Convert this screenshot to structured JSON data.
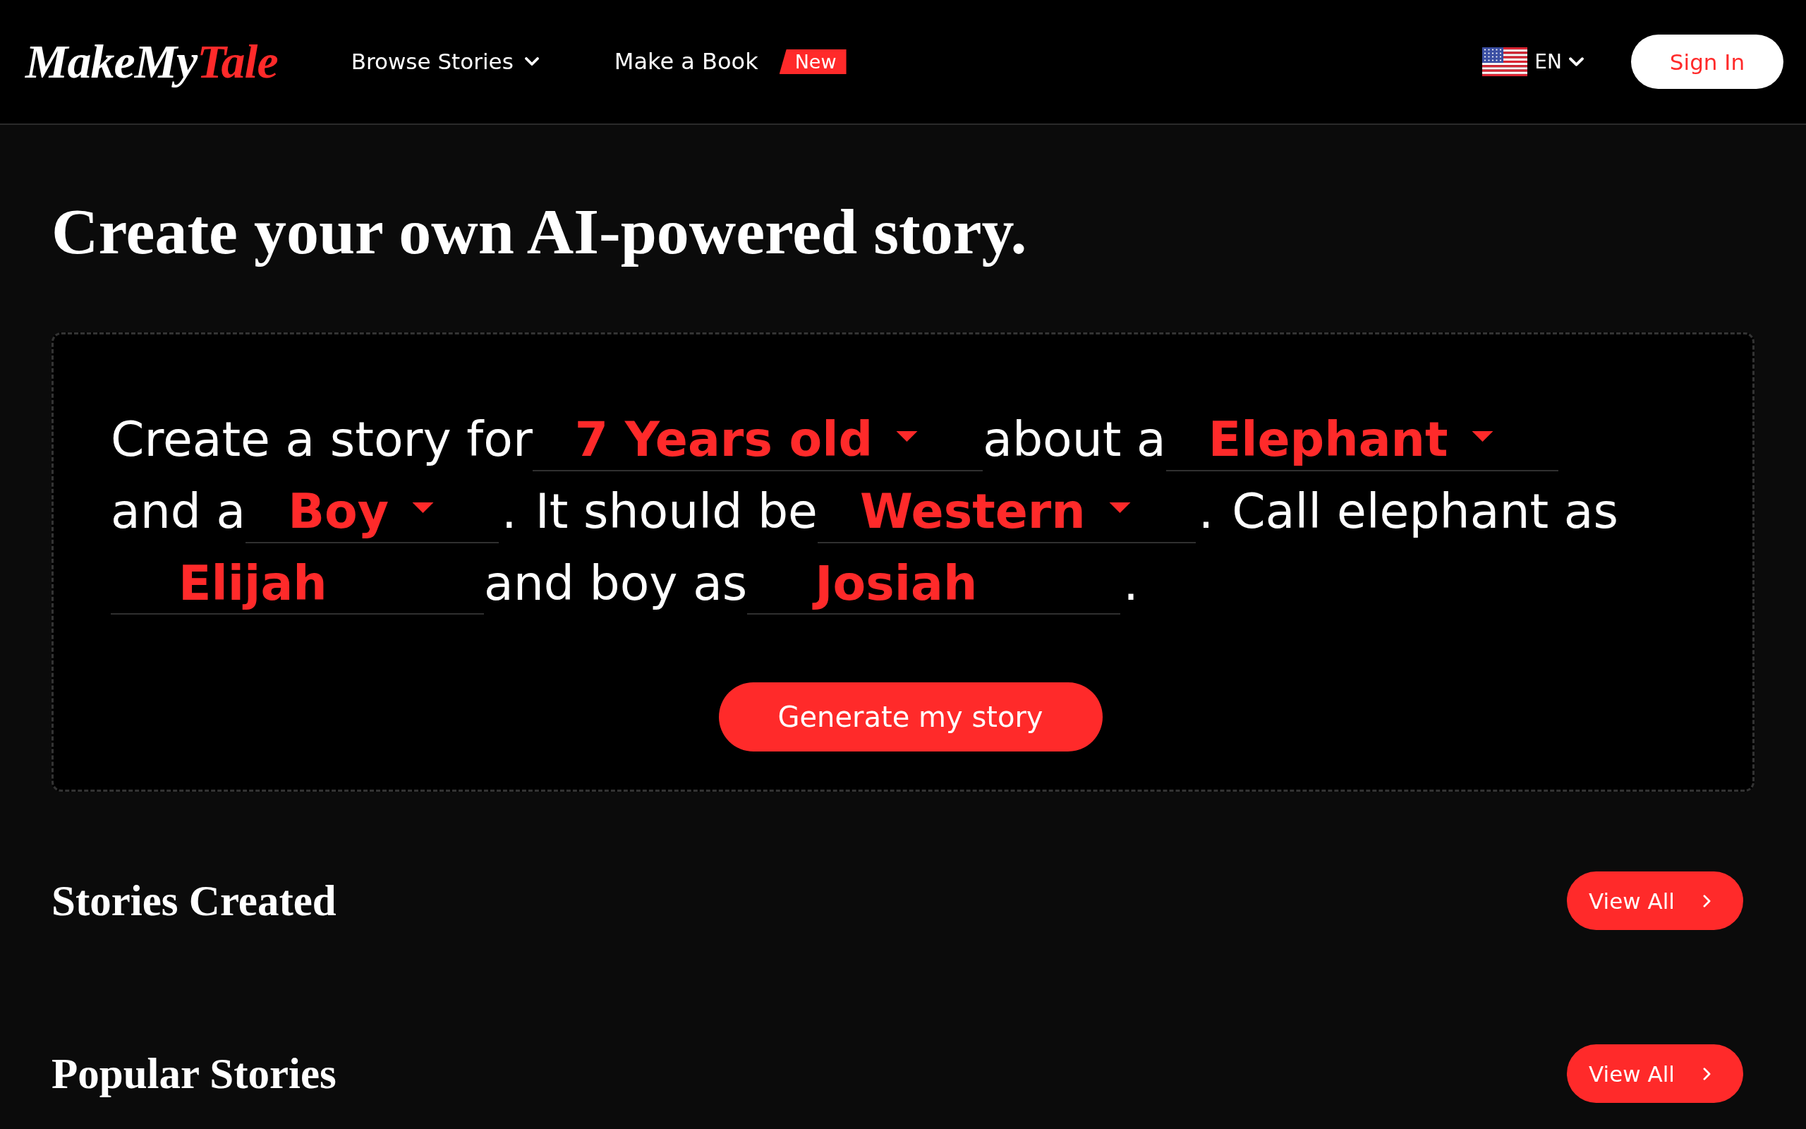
{
  "header": {
    "logo": {
      "parts": [
        {
          "text": "MakeMy",
          "color": "#ffffff"
        },
        {
          "text": "Tale",
          "color": "#ff2a2a"
        }
      ]
    },
    "nav": [
      {
        "kind": "dropdown",
        "label": "Browse Stories"
      },
      {
        "kind": "link",
        "label": "Make a Book",
        "badge": "New"
      }
    ],
    "language": {
      "code": "EN"
    },
    "sign_in": "Sign In"
  },
  "title": "Create your own AI-powered story.",
  "story_form": {
    "lines": [
      [
        {
          "kind": "text",
          "text": "Create a story for"
        },
        {
          "kind": "select",
          "value": "7 Years old"
        },
        {
          "kind": "text",
          "text": "about a"
        },
        {
          "kind": "select",
          "value": "Elephant"
        }
      ],
      [
        {
          "kind": "text",
          "text": "and a"
        },
        {
          "kind": "select",
          "value": "Boy"
        },
        {
          "kind": "punctuation",
          "text": "."
        },
        {
          "kind": "text",
          "text": "It should be"
        },
        {
          "kind": "select",
          "value": "Western"
        },
        {
          "kind": "punctuation",
          "text": "."
        },
        {
          "kind": "text",
          "text": "Call elephant as"
        }
      ],
      [
        {
          "kind": "input",
          "value": "Elijah"
        },
        {
          "kind": "text",
          "text": "and boy as"
        },
        {
          "kind": "input",
          "value": "Josiah"
        },
        {
          "kind": "punctuation",
          "text": "."
        }
      ]
    ],
    "submit": "Generate my story"
  },
  "sections": [
    {
      "title": "Stories Created",
      "action": "View All"
    },
    {
      "title": "Popular Stories",
      "action": "View All"
    }
  ]
}
